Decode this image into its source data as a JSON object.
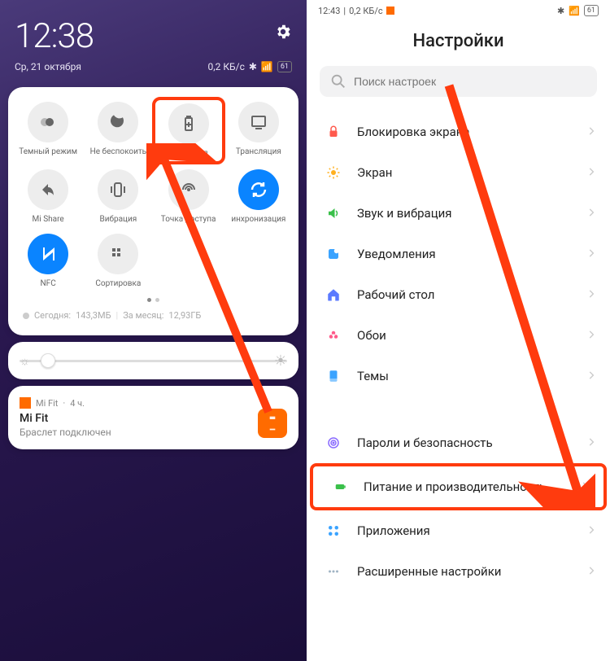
{
  "left": {
    "time": "12:38",
    "date": "Ср, 21 октября",
    "net_status": "0,2 КБ/с",
    "battery": "61",
    "qs": [
      {
        "label": "Темный режим",
        "icon": "dark-mode",
        "name": "dark-mode-toggle"
      },
      {
        "label": "Не беспокоить",
        "icon": "dnd",
        "name": "dnd-toggle"
      },
      {
        "label": "Экономия",
        "icon": "battery-saver",
        "name": "battery-saver-toggle",
        "highlighted": true
      },
      {
        "label": "Трансляция",
        "icon": "cast",
        "name": "cast-toggle"
      },
      {
        "label": "Mi Share",
        "icon": "share",
        "name": "mi-share-toggle"
      },
      {
        "label": "Вибрация",
        "icon": "vibrate",
        "name": "vibrate-toggle"
      },
      {
        "label": "Точка доступа",
        "icon": "hotspot",
        "name": "hotspot-toggle"
      },
      {
        "label": "инхронизация",
        "icon": "sync",
        "name": "sync-toggle",
        "active": true
      },
      {
        "label": "NFC",
        "icon": "nfc",
        "name": "nfc-toggle",
        "active": true
      },
      {
        "label": "Сортировка",
        "icon": "sort",
        "name": "sort-toggle"
      }
    ],
    "usage_today_label": "Сегодня:",
    "usage_today": "143,3МБ",
    "usage_month_label": "За месяц:",
    "usage_month": "12,93ГБ",
    "notif": {
      "app": "Mi Fit",
      "age": "4 ч.",
      "title": "Mi Fit",
      "body": "Браслет подключен"
    }
  },
  "right": {
    "status_time": "12:43",
    "status_net": "0,2 КБ/с",
    "status_battery": "61",
    "title": "Настройки",
    "search_placeholder": "Поиск настроек",
    "items_a": [
      {
        "label": "Блокировка экрана",
        "color": "#ff5a4d",
        "name": "lock-screen-item",
        "icon": "lock"
      },
      {
        "label": "Экран",
        "color": "#ffb020",
        "name": "display-item",
        "icon": "sun"
      },
      {
        "label": "Звук и вибрация",
        "color": "#3ac04a",
        "name": "sound-item",
        "icon": "volume"
      },
      {
        "label": "Уведомления",
        "color": "#3aa3ff",
        "name": "notifications-item",
        "icon": "notif"
      },
      {
        "label": "Рабочий стол",
        "color": "#5b7aff",
        "name": "home-screen-item",
        "icon": "home"
      },
      {
        "label": "Обои",
        "color": "#ff5a8a",
        "name": "wallpaper-item",
        "icon": "flower"
      },
      {
        "label": "Темы",
        "color": "#3aa3ff",
        "name": "themes-item",
        "icon": "theme"
      }
    ],
    "items_b": [
      {
        "label": "Пароли и безопасность",
        "color": "#8a6bff",
        "name": "security-item",
        "icon": "fingerprint"
      },
      {
        "label": "Питание и производительность",
        "color": "#3ac04a",
        "name": "battery-perf-item",
        "icon": "battery",
        "highlighted": true
      },
      {
        "label": "Приложения",
        "color": "#3aa3ff",
        "name": "apps-item",
        "icon": "apps"
      },
      {
        "label": "Расширенные настройки",
        "color": "#a0b4c4",
        "name": "advanced-item",
        "icon": "more"
      }
    ]
  }
}
